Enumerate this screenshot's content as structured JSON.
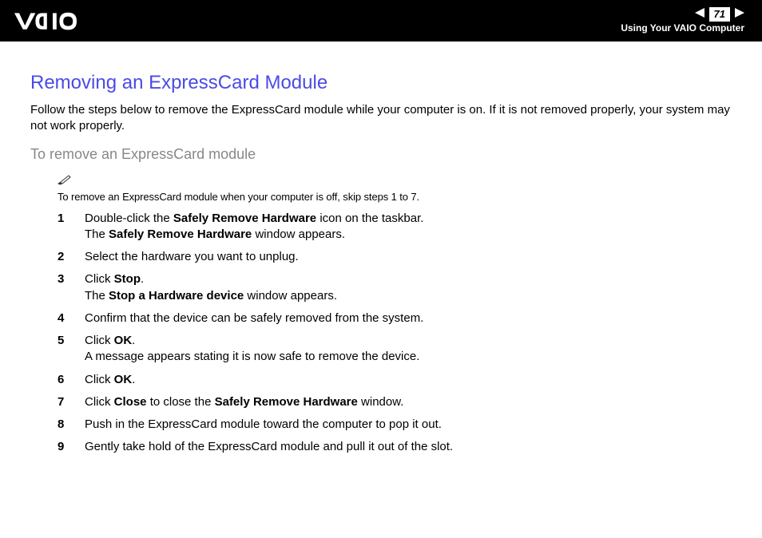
{
  "header": {
    "page_number": "71",
    "chapter": "Using Your VAIO Computer"
  },
  "title": "Removing an ExpressCard Module",
  "intro": "Follow the steps below to remove the ExpressCard module while your computer is on. If it is not removed properly, your system may not work properly.",
  "subhead": "To remove an ExpressCard module",
  "note": "To remove an ExpressCard module when your computer is off, skip steps 1 to 7.",
  "steps": {
    "s1_a": "Double-click the ",
    "s1_b": "Safely Remove Hardware",
    "s1_c": " icon on the taskbar.",
    "s1_d": "The ",
    "s1_e": "Safely Remove Hardware",
    "s1_f": " window appears.",
    "s2": "Select the hardware you want to unplug.",
    "s3_a": "Click ",
    "s3_b": "Stop",
    "s3_c": ".",
    "s3_d": "The ",
    "s3_e": "Stop a Hardware device",
    "s3_f": " window appears.",
    "s4": "Confirm that the device can be safely removed from the system.",
    "s5_a": "Click ",
    "s5_b": "OK",
    "s5_c": ".",
    "s5_d": "A message appears stating it is now safe to remove the device.",
    "s6_a": "Click ",
    "s6_b": "OK",
    "s6_c": ".",
    "s7_a": "Click ",
    "s7_b": "Close",
    "s7_c": " to close the ",
    "s7_d": "Safely Remove Hardware",
    "s7_e": " window.",
    "s8": "Push in the ExpressCard module toward the computer to pop it out.",
    "s9": "Gently take hold of the ExpressCard module and pull it out of the slot."
  },
  "nums": {
    "n1": "1",
    "n2": "2",
    "n3": "3",
    "n4": "4",
    "n5": "5",
    "n6": "6",
    "n7": "7",
    "n8": "8",
    "n9": "9"
  }
}
